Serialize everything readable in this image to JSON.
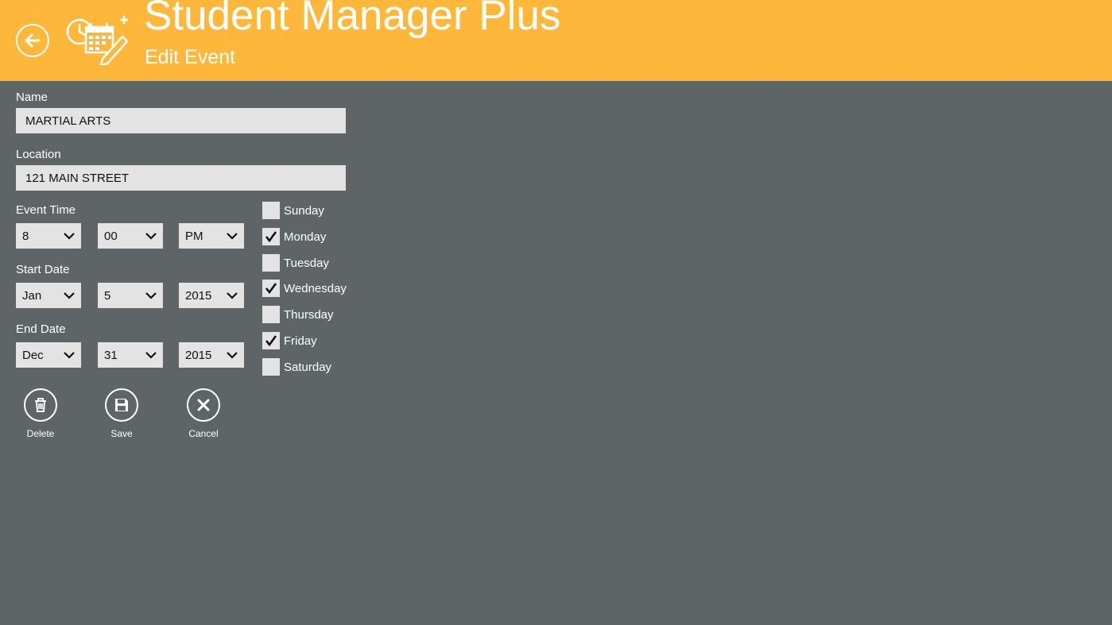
{
  "header": {
    "app_title": "Student Manager Plus",
    "page_subtitle": "Edit Event",
    "back_icon": "back-arrow-icon",
    "logo_icon": "calendar-clock-edit-icon",
    "accent_color": "#fdb83c"
  },
  "form": {
    "name_label": "Name",
    "name_value": "MARTIAL ARTS",
    "location_label": "Location",
    "location_value": "121 MAIN STREET",
    "event_time_label": "Event Time",
    "event_time": {
      "hour": "8",
      "minute": "00",
      "ampm": "PM"
    },
    "start_date_label": "Start Date",
    "start_date": {
      "month": "Jan",
      "day": "5",
      "year": "2015"
    },
    "end_date_label": "End Date",
    "end_date": {
      "month": "Dec",
      "day": "31",
      "year": "2015"
    }
  },
  "days": [
    {
      "label": "Sunday",
      "checked": false
    },
    {
      "label": "Monday",
      "checked": true
    },
    {
      "label": "Tuesday",
      "checked": false
    },
    {
      "label": "Wednesday",
      "checked": true
    },
    {
      "label": "Thursday",
      "checked": false
    },
    {
      "label": "Friday",
      "checked": true
    },
    {
      "label": "Saturday",
      "checked": false
    }
  ],
  "actions": {
    "delete_label": "Delete",
    "save_label": "Save",
    "cancel_label": "Cancel"
  },
  "colors": {
    "background": "#5f6467",
    "field_background": "#e3e3e3"
  }
}
